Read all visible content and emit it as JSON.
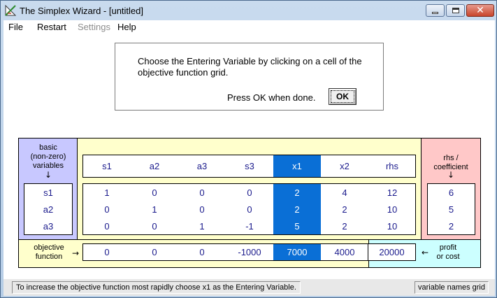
{
  "window": {
    "title": "The Simplex Wizard - [untitled]"
  },
  "menu": [
    "File",
    "Restart",
    "Settings",
    "Help"
  ],
  "dialog": {
    "instruction": "Choose the Entering Variable  by clicking on a cell of the objective function grid.",
    "press_text": "Press OK when done.",
    "ok_label": "OK"
  },
  "panels": {
    "basic_label": "basic\n(non-zero)\nvariables",
    "basic_arrow": "↓",
    "rhs_label": "rhs /\ncoefficient",
    "rhs_arrow": "↓",
    "objective_label": "objective\nfunction",
    "objective_arrow": "→",
    "profit_arrow": "←",
    "profit_label": "profit\nor cost"
  },
  "tableau": {
    "columns": [
      "s1",
      "a2",
      "a3",
      "s3",
      "x1",
      "x2",
      "rhs"
    ],
    "selected_column_index": 4,
    "basic_vars": [
      "s1",
      "a2",
      "a3"
    ],
    "rows": [
      [
        "1",
        "0",
        "0",
        "0",
        "2",
        "4",
        "12"
      ],
      [
        "0",
        "1",
        "0",
        "0",
        "2",
        "2",
        "10"
      ],
      [
        "0",
        "0",
        "1",
        "-1",
        "5",
        "2",
        "10"
      ]
    ],
    "ratios": [
      "6",
      "5",
      "2"
    ],
    "objective": [
      "0",
      "0",
      "0",
      "-1000",
      "7000",
      "4000",
      "20000"
    ]
  },
  "status": {
    "message": "To increase the objective function most rapidly choose x1 as the Entering Variable.",
    "right": "variable names grid"
  },
  "colors": {
    "basic_panel": "#c8c8ff",
    "main_panel": "#ffffcc",
    "rhs_panel": "#ffc8c8",
    "profit_panel": "#ccffff",
    "selection": "#0a6fd6",
    "cell_text": "#1a1a8c"
  }
}
